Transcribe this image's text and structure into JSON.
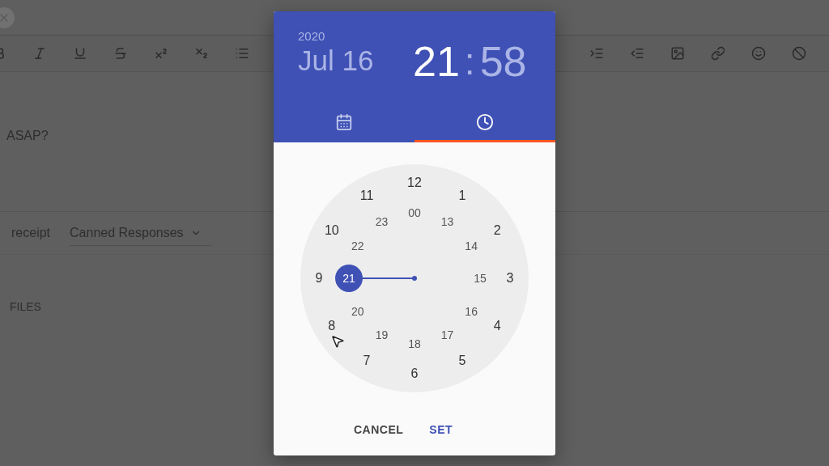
{
  "editor": {
    "body_text": "ASAP?",
    "receipt_label": "receipt",
    "canned_responses": "Canned Responses",
    "files_label": "FILES"
  },
  "picker": {
    "year": "2020",
    "date": "Jul 16",
    "hour": {
      "text": "21",
      "selected": true
    },
    "separator": ":",
    "minute": {
      "text": "58",
      "selected": false
    },
    "tabs": [
      {
        "kind": "calendar",
        "selected": false
      },
      {
        "kind": "clock",
        "selected": true
      }
    ],
    "clock": {
      "outer": [
        {
          "label": "12",
          "selected": false
        },
        {
          "label": "1",
          "selected": false
        },
        {
          "label": "2",
          "selected": false
        },
        {
          "label": "3",
          "selected": false
        },
        {
          "label": "4",
          "selected": false
        },
        {
          "label": "5",
          "selected": false
        },
        {
          "label": "6",
          "selected": false
        },
        {
          "label": "7",
          "selected": false
        },
        {
          "label": "8",
          "selected": false
        },
        {
          "label": "9",
          "selected": false
        },
        {
          "label": "10",
          "selected": false
        },
        {
          "label": "11",
          "selected": false
        }
      ],
      "inner": [
        {
          "label": "00",
          "selected": false
        },
        {
          "label": "13",
          "selected": false
        },
        {
          "label": "14",
          "selected": false
        },
        {
          "label": "15",
          "selected": false
        },
        {
          "label": "16",
          "selected": false
        },
        {
          "label": "17",
          "selected": false
        },
        {
          "label": "18",
          "selected": false
        },
        {
          "label": "19",
          "selected": false
        },
        {
          "label": "20",
          "selected": false
        },
        {
          "label": "21",
          "selected": true
        },
        {
          "label": "22",
          "selected": false
        },
        {
          "label": "23",
          "selected": false
        }
      ]
    },
    "buttons": [
      {
        "kind": "cancel",
        "label": "CANCEL"
      },
      {
        "kind": "confirm",
        "label": "SET"
      }
    ]
  }
}
